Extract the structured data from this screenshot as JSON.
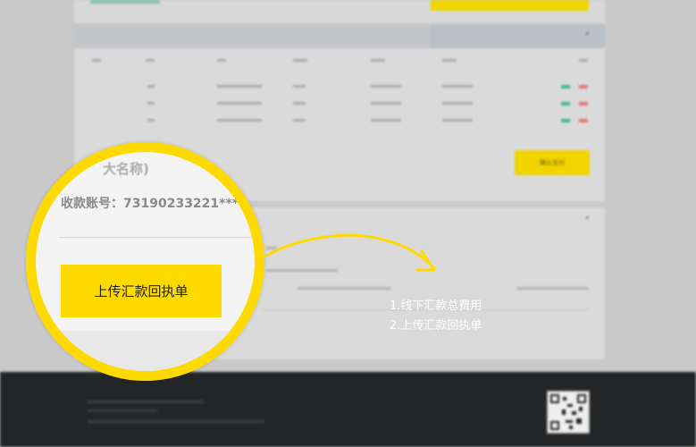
{
  "background": {
    "confirm_button": "确认支付"
  },
  "magnifier": {
    "title_fragment": "大名称)",
    "account_label": "收款账号：",
    "account_value": "73190233221****",
    "upload_button": "上传汇款回执单"
  },
  "notes": [
    "1.线下汇款总费用",
    "2.上传汇款回执单"
  ],
  "colors": {
    "accent_yellow": "#ffda00",
    "footer_dark": "#232526",
    "status_green": "#3fb58d",
    "status_red": "#e57474"
  },
  "icons": [
    "chevron-down-icon",
    "curved-arrow-icon",
    "qr-code-icon"
  ]
}
